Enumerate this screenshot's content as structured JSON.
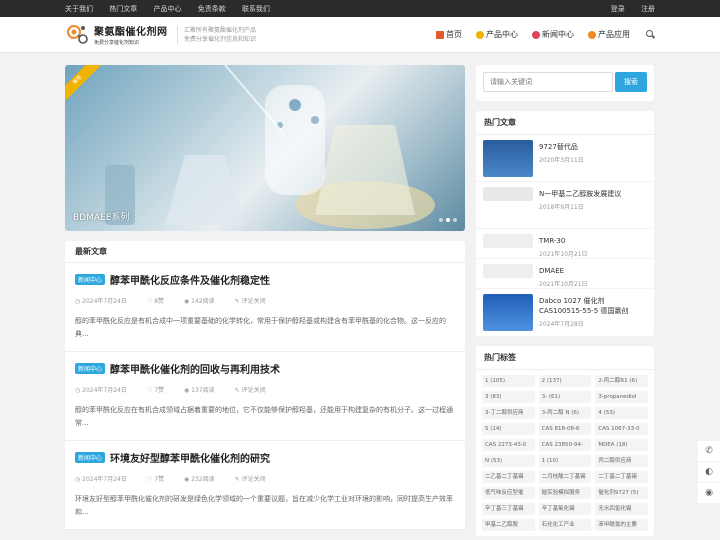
{
  "topbar": {
    "links": [
      "关于我们",
      "热门文章",
      "产品中心",
      "免责条款",
      "联系我们"
    ],
    "login": "登录",
    "register": "注册"
  },
  "header": {
    "logo_title": "聚氨酯催化剂网",
    "logo_sub": "免费分享催化剂知识",
    "slogan_1": "汇聚所有聚氨酯催化剂产品",
    "slogan_2": "免费分享催化剂信息和知识",
    "nav": [
      {
        "label": "首页",
        "icon": "home-icon",
        "color": "#e05a2b"
      },
      {
        "label": "产品中心",
        "icon": "product-icon",
        "color": "#f0b400"
      },
      {
        "label": "新闻中心",
        "icon": "news-icon",
        "color": "#e0445a"
      },
      {
        "label": "产品应用",
        "icon": "apps-icon",
        "color": "#f08a24"
      }
    ]
  },
  "slider": {
    "ribbon": "推荐",
    "caption": "BDMAEE系列"
  },
  "latest": {
    "heading": "最新文章",
    "posts": [
      {
        "cat": "新闻中心",
        "title": "醇苯甲酰化反应条件及催化剂稳定性",
        "date": "2024年7月24日",
        "likes": "8赞",
        "views": "142阅读",
        "comments": "评论关闭",
        "excerpt": "醇的苯甲酰化反应是有机合成中一项重要基础的化学转化，常用于保护醇羟基或构建含有苯甲酰基的化合物。这一反应的典..."
      },
      {
        "cat": "新闻中心",
        "title": "醇苯甲酰化催化剂的回收与再利用技术",
        "date": "2024年7月24日",
        "likes": "7赞",
        "views": "137阅读",
        "comments": "评论关闭",
        "excerpt": "醇的苯甲酰化反应在有机合成领域占据着重要的地位，它不仅能够保护醇羟基，还能用于构建复杂的有机分子。这一过程通常..."
      },
      {
        "cat": "新闻中心",
        "title": "环境友好型醇苯甲酰化催化剂的研究",
        "date": "2024年7月24日",
        "likes": "7赞",
        "views": "232阅读",
        "comments": "评论关闭",
        "excerpt": "环境友好型醇苯甲酰化催化剂的研发是绿色化学领域的一个重要议题，旨在减少化学工业对环境的影响，同时提高生产效率和..."
      }
    ]
  },
  "sidebar": {
    "search_placeholder": "请输入关键词",
    "search_button": "搜索",
    "hot_heading": "热门文章",
    "hot": [
      {
        "title": "9727替代品",
        "date": "2020年3月11日",
        "thumb": "#3a6fb0"
      },
      {
        "title": "N一甲基二乙醇胺发展建议",
        "date": "2018年9月11日",
        "thumb": "#e8e8e8"
      },
      {
        "title": "TMR-30",
        "date": "2021年10月21日",
        "thumb": "#eeeeee"
      },
      {
        "title": "DMAEE",
        "date": "2021年10月21日",
        "thumb": "#eeeeee"
      },
      {
        "title": "Dabco 1027 催化剂 CAS100515-55-5 德国赢创",
        "date": "2024年7月28日",
        "thumb": "#2f6fc6"
      }
    ],
    "tags_heading": "热门标签",
    "tags": [
      "1 (105)",
      "2 (137)",
      "2-丙二醇R1 (6)",
      "3 (83)",
      "3- (61)",
      "3-propanediol",
      "3-丁二醇供应商",
      "3-丙二醇 N (6)",
      "4 (53)",
      "5 (14)",
      "CAS 818-08-6",
      "CAS 1067-33-0",
      "CAS 2273-43-0",
      "CAS 23850-94-",
      "MDEA (18)",
      "N (53)",
      "1 (10)",
      "丙二醇供应商",
      "二乙基二丁基锡",
      "二月桂酸二丁基锡",
      "二丁基二丁基锡",
      "低气味反应型催",
      "催实验模拟服务",
      "催化剂9727 (5)",
      "辛丁基三丁基锡",
      "辛丁基氧化锡",
      "无水四氢化锡",
      "甲基二乙醇胺",
      "石化化工产业",
      "苯甲酰氯的主要"
    ]
  },
  "float": [
    "phone-icon",
    "wechat-icon",
    "weibo-icon"
  ]
}
